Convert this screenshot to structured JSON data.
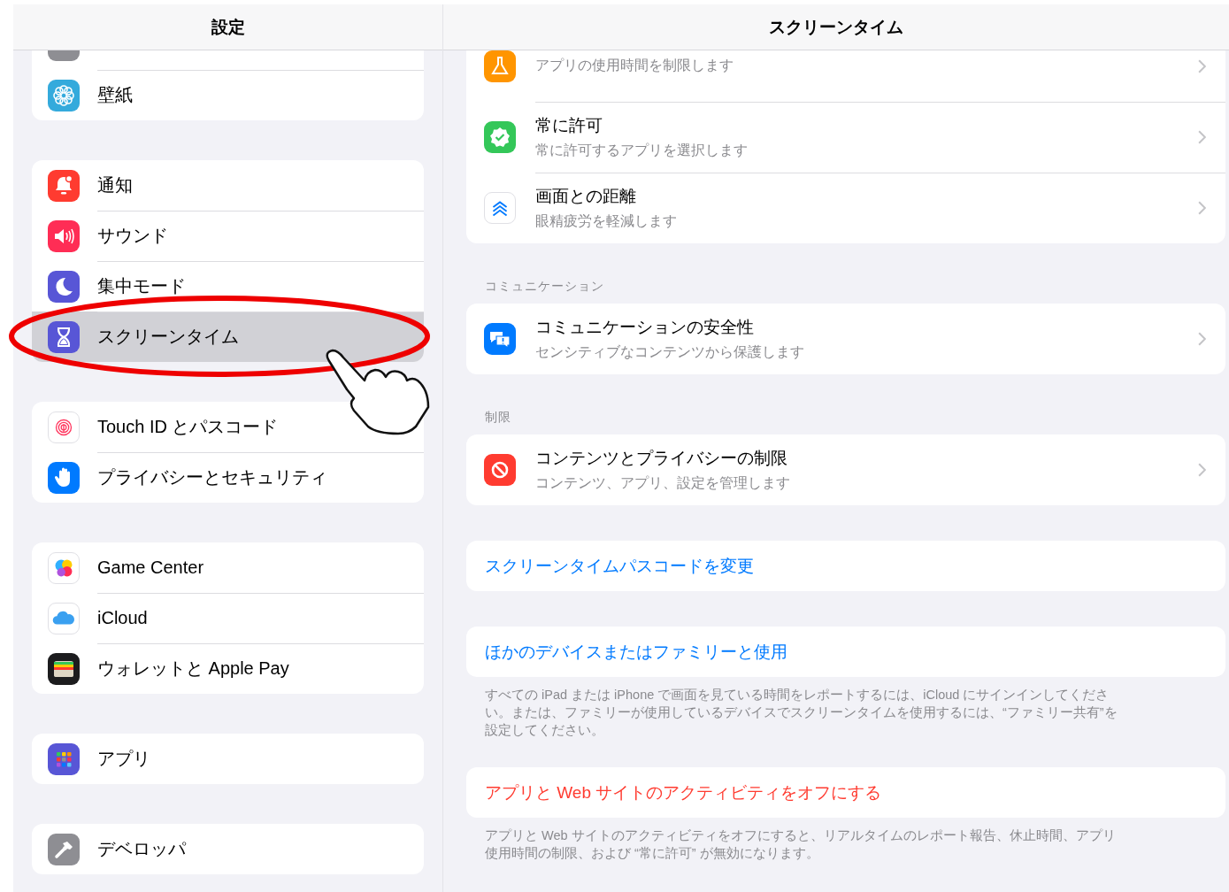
{
  "sidebar": {
    "title": "設定",
    "groups": [
      {
        "items": [
          {
            "kind": "display",
            "selected": false
          },
          {
            "kind": "wallpaper",
            "label": "壁紙",
            "selected": false
          }
        ]
      },
      {
        "items": [
          {
            "kind": "notifications",
            "label": "通知",
            "selected": false
          },
          {
            "kind": "sound",
            "label": "サウンド",
            "selected": false
          },
          {
            "kind": "focus",
            "label": "集中モード",
            "selected": false
          },
          {
            "kind": "screentime",
            "label": "スクリーンタイム",
            "selected": true
          }
        ]
      },
      {
        "items": [
          {
            "kind": "touchid",
            "label": "Touch ID とパスコード",
            "selected": false
          },
          {
            "kind": "privacy",
            "label": "プライバシーとセキュリティ",
            "selected": false
          }
        ]
      },
      {
        "items": [
          {
            "kind": "gamecenter",
            "label": "Game Center",
            "selected": false
          },
          {
            "kind": "icloud",
            "label": "iCloud",
            "selected": false
          },
          {
            "kind": "wallet",
            "label": "ウォレットと Apple Pay",
            "selected": false
          }
        ]
      },
      {
        "items": [
          {
            "kind": "apps",
            "label": "アプリ",
            "selected": false
          }
        ]
      },
      {
        "items": [
          {
            "kind": "developer",
            "label": "デベロッパ",
            "selected": false
          }
        ]
      }
    ]
  },
  "detail": {
    "title": "スクリーンタイム",
    "sections": [
      {
        "rows": [
          {
            "kind": "limits",
            "subtitle": "アプリの使用時間を制限します"
          },
          {
            "kind": "allowed",
            "title": "常に許可",
            "subtitle": "常に許可するアプリを選択します"
          },
          {
            "kind": "distance",
            "title": "画面との距離",
            "subtitle": "眼精疲労を軽減します"
          }
        ]
      },
      {
        "header": "コミュニケーション",
        "rows": [
          {
            "kind": "communication",
            "title": "コミュニケーションの安全性",
            "subtitle": "センシティブなコンテンツから保護します"
          }
        ]
      },
      {
        "header": "制限",
        "rows": [
          {
            "kind": "restrictions",
            "title": "コンテンツとプライバシーの制限",
            "subtitle": "コンテンツ、アプリ、設定を管理します"
          }
        ]
      },
      {
        "rows": [
          {
            "kind": "link",
            "title": "スクリーンタイムパスコードを変更",
            "color": "#007aff"
          }
        ]
      },
      {
        "rows": [
          {
            "kind": "link",
            "title": "ほかのデバイスまたはファミリーと使用",
            "color": "#007aff"
          }
        ],
        "footer": "すべての iPad または iPhone で画面を見ている時間をレポートするには、iCloud にサインインしてください。または、ファミリーが使用しているデバイスでスクリーンタイムを使用するには、“ファミリー共有”を設定してください。"
      },
      {
        "rows": [
          {
            "kind": "link",
            "title": "アプリと Web サイトのアクティビティをオフにする",
            "color": "#ff3b30"
          }
        ],
        "footer": "アプリと Web サイトのアクティビティをオフにすると、リアルタイムのレポート報告、休止時間、アプリ使用時間の制限、および “常に許可” が無効になります。"
      }
    ]
  }
}
